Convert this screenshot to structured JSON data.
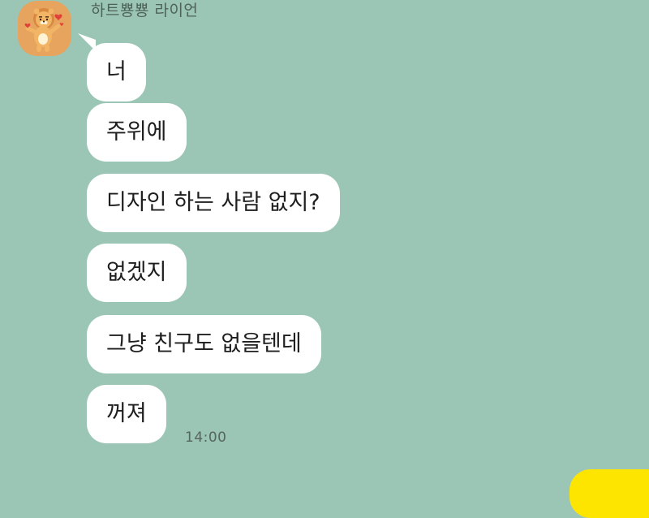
{
  "sender": {
    "name": "하트뿅뿅 라이언",
    "avatar_icon": "lion-character-icon"
  },
  "messages": [
    {
      "text": "너"
    },
    {
      "text": "주위에"
    },
    {
      "text": "디자인 하는 사람 없지?"
    },
    {
      "text": "없겠지"
    },
    {
      "text": "그냥 친구도 없을텐데"
    },
    {
      "text": "꺼져"
    }
  ],
  "last_message_time": "14:00",
  "colors": {
    "background": "#9bc5b5",
    "incoming_bubble": "#ffffff",
    "outgoing_bubble": "#fee500",
    "avatar_bg": "#e6a45e"
  }
}
